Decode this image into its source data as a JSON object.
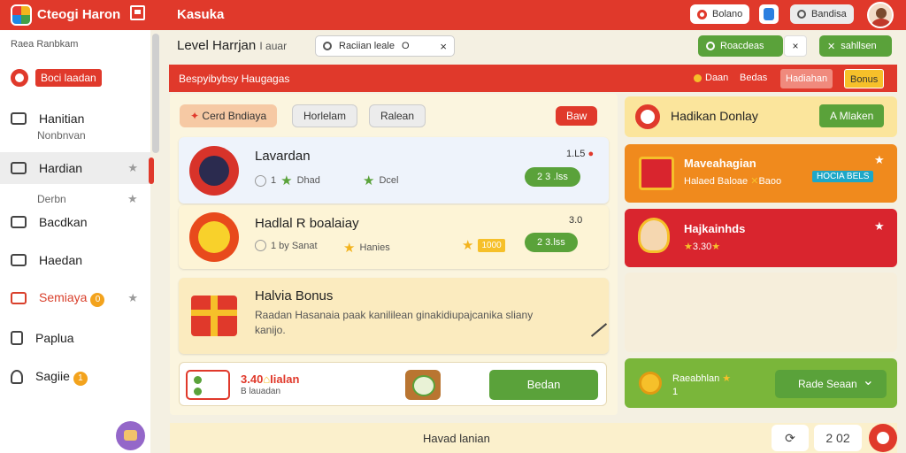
{
  "topbar": {
    "app_title": "Cteogi Haron",
    "section_title": "Kasuka",
    "search_label": "Bolano",
    "secondary_label": "Bandisa"
  },
  "sidebar": {
    "header": "Raea Ranbkam",
    "promo_label": "Boci laadan",
    "items": [
      {
        "label": "Hanitian",
        "sub": "Nonbnvan"
      },
      {
        "label": "Hardian",
        "sub": "Derbn"
      },
      {
        "label": "Bacdkan"
      },
      {
        "label": "Haedan"
      },
      {
        "label": "Semiaya",
        "badge": "0"
      },
      {
        "label": "Paplua"
      },
      {
        "label": "Sagiie",
        "badge": "1"
      }
    ]
  },
  "main": {
    "title": "Level Harrjan",
    "title_suffix": "I auar",
    "search_text": "Raciian leale",
    "search_circle": "O",
    "green_action_1": "Roacdeas",
    "green_action_2": "sahllsen",
    "close_glyph": "×",
    "banner_text": "Bespyibybsy Haugagas",
    "banner_link_1": "Daan",
    "banner_link_2": "Bedas",
    "banner_tab_1": "Hadiahan",
    "banner_tab_2": "Bonus"
  },
  "tabs": {
    "tab1": "Cerd Bndiaya",
    "tab2": "Horlelam",
    "tab3": "Ralean",
    "tab4": "Baw"
  },
  "cards": [
    {
      "title": "Lavardan",
      "meta1": "1",
      "meta2": "Dhad",
      "meta3": "Dcel",
      "price": "1.L5",
      "button": "2 3 .lss"
    },
    {
      "title": "Hadlal R boalaiay",
      "meta1": "1 by Sanat",
      "meta2": "Hanies",
      "price": "3.0",
      "gold": "1000",
      "button": "2 3.lss"
    }
  ],
  "bonus": {
    "title": "Halvia Bonus",
    "text_line1": "Raadan Hasanaia paak kanililean ginakidiupajcanika sliany",
    "text_line2": "kanijo."
  },
  "bottom": {
    "amount": "3.40",
    "amount_suffix": "Iialan",
    "sub": "B lauadan",
    "cta": "Bedan"
  },
  "footer": {
    "label": "Havad lanian",
    "btn_value": "2 02"
  },
  "right": {
    "card1_title": "Hadikan Donlay",
    "card1_button": "A Mlaken",
    "card2_title": "Maveahagian",
    "card2_sub": "Halaed Baloae",
    "card2_sub2": "Baoo",
    "card2_tag": "HOCIA BELS",
    "card3_title": "Hajkainhds",
    "card3_sub": "3.30",
    "card4_title": "Raeabhlan",
    "card4_sub": "1",
    "card4_select": "Rade Seaan"
  },
  "icons": {
    "app": "app-logo-icon",
    "window": "window-icon",
    "search": "search-icon",
    "star": "star-icon",
    "gift": "gift-icon",
    "chest": "treasure-chest-icon",
    "coin": "coin-icon"
  },
  "colors": {
    "brand_red": "#e0392b",
    "accent_green": "#5aa23a",
    "accent_orange": "#f08a1d",
    "accent_gold": "#f6c02a",
    "panel_cream": "#fbf5df"
  }
}
